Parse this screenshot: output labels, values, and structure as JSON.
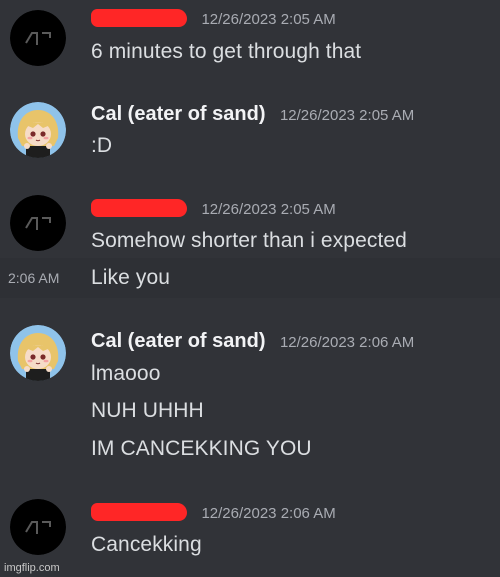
{
  "messages": {
    "group1": {
      "timestamp": "12/26/2023 2:05 AM",
      "lines": [
        "6 minutes to get through that"
      ]
    },
    "group2": {
      "author": "Cal (eater of sand)",
      "timestamp": "12/26/2023 2:05 AM",
      "lines": [
        ":D"
      ]
    },
    "group3": {
      "timestamp": "12/26/2023 2:05 AM",
      "lines": [
        "Somehow shorter than i expected"
      ],
      "followup_time": "2:06 AM",
      "followup_text": "Like you"
    },
    "group4": {
      "author": "Cal (eater of sand)",
      "timestamp": "12/26/2023 2:06 AM",
      "lines": [
        "lmaooo",
        "NUH UHHH",
        "IM CANCEKKING YOU"
      ]
    },
    "group5": {
      "timestamp": "12/26/2023 2:06 AM",
      "lines": [
        "Cancekking"
      ]
    }
  },
  "watermark": "imgflip.com",
  "colors": {
    "background": "#313338",
    "hover_background": "#2e3035",
    "redaction": "#ff2626",
    "text": "#dbdee1",
    "timestamp": "#a9acb3"
  },
  "icons": {
    "black_avatar": "black-avatar-icon",
    "cal_avatar": "anime-avatar-icon"
  }
}
